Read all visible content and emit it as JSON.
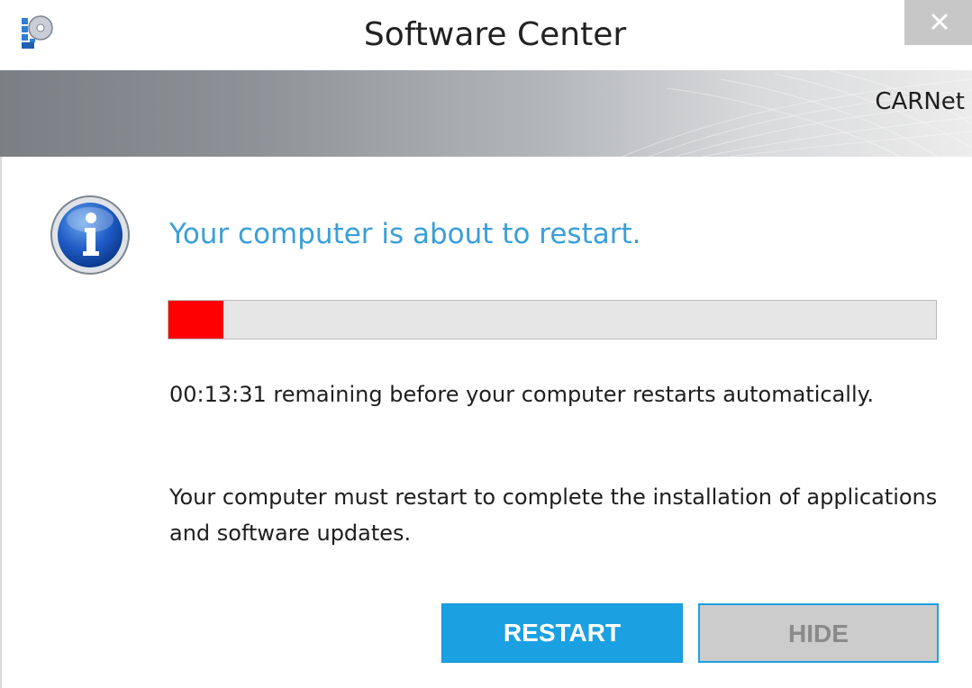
{
  "window": {
    "title": "Software Center",
    "app_icon": "software-center-icon",
    "close_icon": "close-icon"
  },
  "banner": {
    "brand": "CARNet"
  },
  "dialog": {
    "icon": "info-icon",
    "heading": "Your computer is about to restart.",
    "progress_fraction": 0.072,
    "progress_color": "#ff0000",
    "countdown_text": "00:13:31 remaining before your computer restarts automatically.",
    "message": "Your computer must restart to complete the installation of applications and software updates."
  },
  "buttons": {
    "restart_label": "RESTART",
    "hide_label": "HIDE"
  },
  "colors": {
    "accent": "#1ba1e2",
    "heading": "#3a9fd8"
  }
}
